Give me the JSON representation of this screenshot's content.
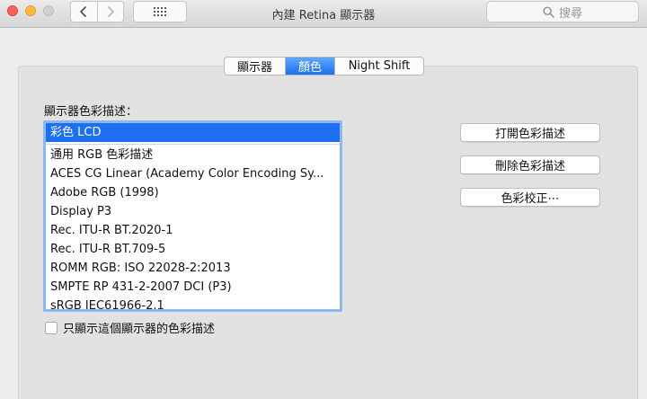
{
  "window": {
    "title": "內建 Retina 顯示器"
  },
  "toolbar": {
    "back_icon": "chevron-left-icon",
    "forward_icon": "chevron-right-icon",
    "grid_icon": "grid-icon",
    "search_placeholder": "搜尋"
  },
  "tabs": [
    {
      "label": "顯示器",
      "active": false
    },
    {
      "label": "顏色",
      "active": true
    },
    {
      "label": "Night Shift",
      "active": false
    }
  ],
  "color_profiles": {
    "label": "顯示器色彩描述：",
    "selected": "彩色 LCD",
    "items": [
      "彩色 LCD",
      "通用 RGB 色彩描述",
      "ACES CG Linear (Academy Color Encoding Sy...",
      "Adobe RGB (1998)",
      "Display P3",
      "Rec. ITU-R BT.2020-1",
      "Rec. ITU-R BT.709-5",
      "ROMM RGB: ISO 22028-2:2013",
      "SMPTE RP 431-2-2007 DCI (P3)",
      "sRGB IEC61966-2.1"
    ]
  },
  "buttons": {
    "open": "打開色彩描述",
    "delete": "刪除色彩描述",
    "calibrate": "色彩校正⋯"
  },
  "options": {
    "show_only_label": "只顯示這個顯示器的色彩描述",
    "show_only_checked": false
  },
  "colors": {
    "accent": "#1c6ff1",
    "close": "#fc605b",
    "minimize": "#fdbc40",
    "zoom_disabled": "#cfcfcf"
  }
}
